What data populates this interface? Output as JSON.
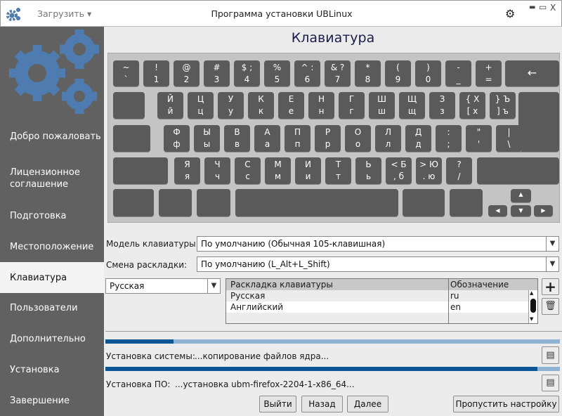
{
  "window": {
    "title": "Программа установки UBLinux",
    "load_menu": "Загрузить ▾",
    "app_icon": "gears-icon",
    "settings_icon": "gear-icon",
    "controls": {
      "min": "▬",
      "max": "▭",
      "close": "X"
    }
  },
  "sidebar": {
    "items": [
      {
        "label": "Добро пожаловать"
      },
      {
        "label": "Лицензионное соглашение"
      },
      {
        "label": "Подготовка"
      },
      {
        "label": "Местоположение"
      },
      {
        "label": "Клавиатура",
        "selected": true
      },
      {
        "label": "Пользователи"
      },
      {
        "label": "Дополнительно"
      },
      {
        "label": "Установка"
      },
      {
        "label": "Завершение"
      }
    ]
  },
  "page": {
    "title": "Клавиатура"
  },
  "keyboard": {
    "rows": [
      [
        [
          "~",
          "`"
        ],
        [
          "!",
          "1"
        ],
        [
          "@",
          "2"
        ],
        [
          "#",
          "3"
        ],
        [
          "$ ;",
          "4"
        ],
        [
          "%",
          "5"
        ],
        [
          "^ :",
          "6"
        ],
        [
          "& ?",
          "7"
        ],
        [
          "*",
          "8"
        ],
        [
          "(",
          "9"
        ],
        [
          ")",
          "0"
        ],
        [
          "-",
          "_"
        ],
        [
          "+",
          "="
        ],
        [
          "←",
          ""
        ]
      ],
      [
        [
          "",
          ""
        ],
        [
          "Й",
          "й"
        ],
        [
          "Ц",
          "ц"
        ],
        [
          "У",
          "у"
        ],
        [
          "К",
          "к"
        ],
        [
          "Е",
          "е"
        ],
        [
          "Н",
          "н"
        ],
        [
          "Г",
          "г"
        ],
        [
          "Ш",
          "ш"
        ],
        [
          "Щ",
          "щ"
        ],
        [
          "З",
          "з"
        ],
        [
          "{ Х",
          "[ х"
        ],
        [
          "} Ъ",
          "] ъ"
        ],
        [
          "",
          ""
        ]
      ],
      [
        [
          "",
          ""
        ],
        [
          "Ф",
          "ф"
        ],
        [
          "Ы",
          "ы"
        ],
        [
          "В",
          "в"
        ],
        [
          "А",
          "а"
        ],
        [
          "П",
          "п"
        ],
        [
          "Р",
          "р"
        ],
        [
          "О",
          "о"
        ],
        [
          "Л",
          "л"
        ],
        [
          "Д",
          "д"
        ],
        [
          ":",
          ";"
        ],
        [
          "\"",
          "'"
        ],
        [
          "|",
          "\\"
        ]
      ],
      [
        [
          "",
          ""
        ],
        [
          "Я",
          "я"
        ],
        [
          "Ч",
          "ч"
        ],
        [
          "С",
          "с"
        ],
        [
          "М",
          "м"
        ],
        [
          "И",
          "и"
        ],
        [
          "Т",
          "т"
        ],
        [
          "Ь",
          "ь"
        ],
        [
          "< Б",
          ", б"
        ],
        [
          "> Ю",
          ". ю"
        ],
        [
          "?",
          "/"
        ],
        [
          "",
          ""
        ]
      ],
      [
        [
          "",
          ""
        ],
        [
          "",
          ""
        ],
        [
          "",
          ""
        ],
        [
          "",
          ""
        ],
        [
          "",
          ""
        ],
        [
          "",
          ""
        ],
        [
          "▲",
          ""
        ],
        [
          "◀",
          ""
        ],
        [
          "▼",
          ""
        ],
        [
          "▶",
          ""
        ]
      ]
    ]
  },
  "form": {
    "model_label": "Модель клавиатуры:",
    "model_value": "По умолчанию (Обычная 105-клавишная)",
    "switch_label": "Смена раскладки:",
    "switch_value": "По умолчанию (L_Alt+L_Shift)",
    "layout_value": "Русская"
  },
  "layouts_table": {
    "headers": [
      "Раскладка клавиатуры",
      "Обозначение"
    ],
    "rows": [
      [
        "Русская",
        "ru"
      ],
      [
        "Английский",
        "en"
      ]
    ]
  },
  "progress": {
    "system_label": "Установка системы:",
    "system_status": "...копирование файлов ядра...",
    "system_percent": 15,
    "software_label": "Установка ПО:",
    "software_status": "...установка ubm-firefox-2204-1-x86_64...",
    "software_percent": 95
  },
  "buttons": {
    "exit": "Выйти",
    "back": "Назад",
    "next": "Далее",
    "skip": "Пропустить настройку"
  },
  "colors": {
    "accent": "#0c5596",
    "sidebar": "#616161",
    "logo": "#4e7bb0"
  }
}
